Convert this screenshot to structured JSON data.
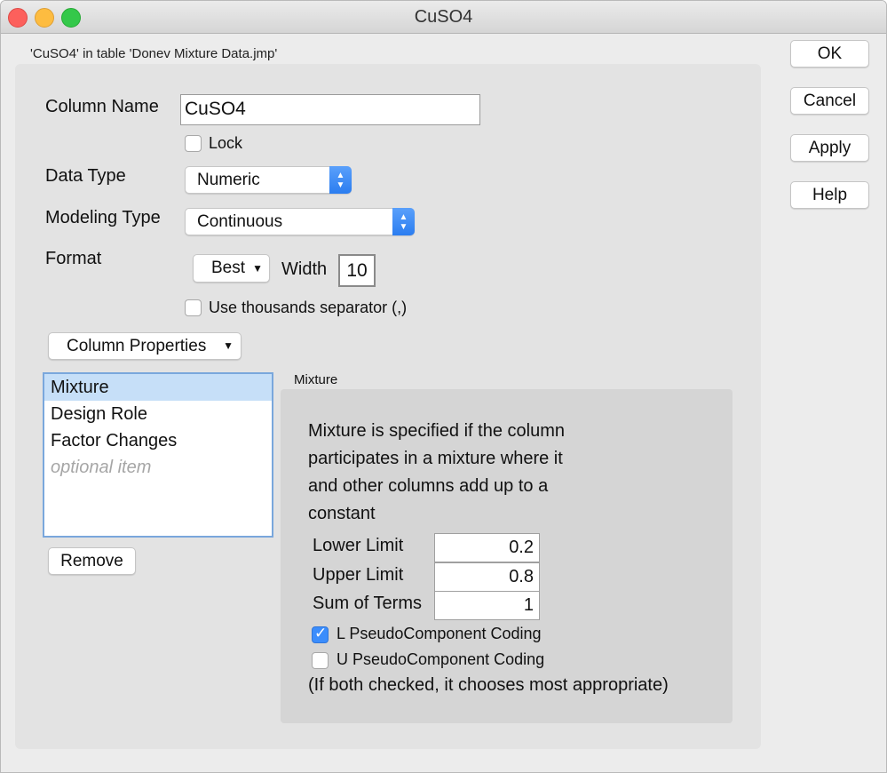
{
  "window": {
    "title": "CuSO4",
    "table_caption": "'CuSO4' in table 'Donev Mixture Data.jmp'"
  },
  "form": {
    "column_name_label": "Column Name",
    "column_name_value": "CuSO4",
    "lock_label": "Lock",
    "lock_checked": false,
    "data_type_label": "Data Type",
    "data_type_value": "Numeric",
    "modeling_type_label": "Modeling Type",
    "modeling_type_value": "Continuous",
    "format_label": "Format",
    "format_value": "Best",
    "width_label": "Width",
    "width_value": "10",
    "thousands_label": "Use thousands separator (,)",
    "thousands_checked": false,
    "column_properties_label": "Column Properties"
  },
  "properties_list": {
    "items": [
      {
        "label": "Mixture",
        "selected": true
      },
      {
        "label": "Design Role",
        "selected": false
      },
      {
        "label": "Factor Changes",
        "selected": false
      },
      {
        "label": "optional item",
        "placeholder": true
      }
    ],
    "remove_label": "Remove"
  },
  "mixture": {
    "heading": "Mixture",
    "description_lines": [
      "Mixture is specified if the column",
      "participates in a mixture where it",
      "and other columns add up to a",
      "constant"
    ],
    "lower_limit_label": "Lower Limit",
    "lower_limit_value": "0.2",
    "upper_limit_label": "Upper Limit",
    "upper_limit_value": "0.8",
    "sum_terms_label": "Sum of Terms",
    "sum_terms_value": "1",
    "l_pseudo_label": "L PseudoComponent Coding",
    "l_pseudo_checked": true,
    "u_pseudo_label": "U PseudoComponent Coding",
    "u_pseudo_checked": false,
    "note": "(If both checked, it chooses most appropriate)"
  },
  "buttons": {
    "ok": "OK",
    "cancel": "Cancel",
    "apply": "Apply",
    "help": "Help"
  },
  "colors": {
    "accent": "#3b8dfc",
    "list_selection": "#c6dff8",
    "close": "#fc605c",
    "minimize": "#fdbc40",
    "maximize": "#34c84a"
  }
}
